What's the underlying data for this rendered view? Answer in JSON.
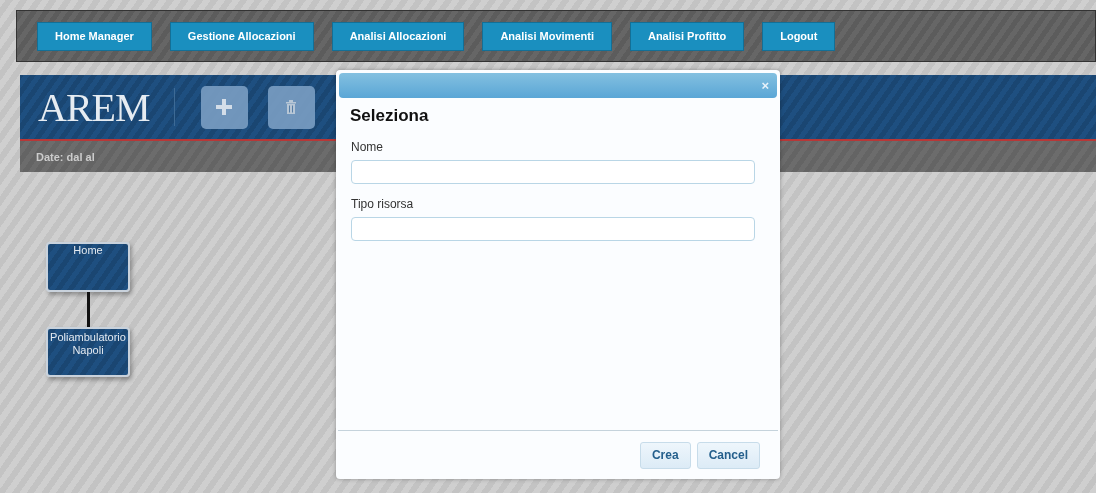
{
  "nav": [
    "Home Manager",
    "Gestione Allocazioni",
    "Analisi Allocazioni",
    "Analisi Movimenti",
    "Analisi Profitto",
    "Logout"
  ],
  "header": {
    "logo": "AREM"
  },
  "date_bar": "Date: dal al",
  "tree": {
    "label": "Home",
    "children": [
      {
        "label": "Poliambulatorio Napoli"
      }
    ]
  },
  "dialog": {
    "close": "×",
    "title": "Seleziona",
    "fields": [
      {
        "label": "Nome"
      },
      {
        "label": "Tipo risorsa"
      }
    ],
    "buttons": [
      "Crea",
      "Cancel"
    ]
  }
}
